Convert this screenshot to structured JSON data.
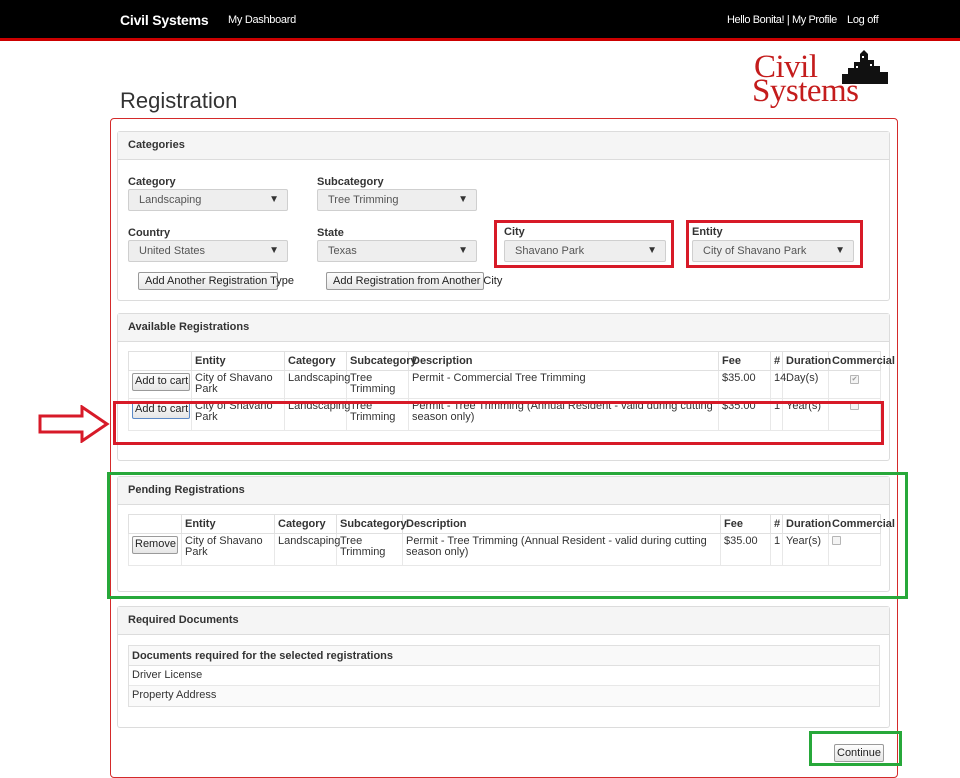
{
  "nav": {
    "brand": "Civil Systems",
    "dashboard": "My Dashboard",
    "greeting": "Hello Bonita! | My Profile",
    "logoff": "Log off"
  },
  "logo": {
    "line1": "Civil",
    "line2": "Systems"
  },
  "page_title": "Registration",
  "categories": {
    "heading": "Categories",
    "category_label": "Category",
    "category_value": "Landscaping",
    "subcategory_label": "Subcategory",
    "subcategory_value": "Tree Trimming",
    "country_label": "Country",
    "country_value": "United States",
    "state_label": "State",
    "state_value": "Texas",
    "city_label": "City",
    "city_value": "Shavano Park",
    "entity_label": "Entity",
    "entity_value": "City of Shavano Park",
    "add_type_button": "Add Another Registration Type",
    "add_city_button": "Add Registration from Another City"
  },
  "available": {
    "heading": "Available Registrations",
    "columns": [
      "Entity",
      "Category",
      "Subcategory",
      "Description",
      "Fee",
      "#",
      "Duration",
      "Commercial"
    ],
    "button_label": "Add to cart",
    "rows": [
      {
        "entity": "City of Shavano Park",
        "category": "Landscaping",
        "subcategory": "Tree Trimming",
        "description": "Permit - Commercial Tree Trimming",
        "fee": "$35.00",
        "count": "14",
        "duration": "Day(s)",
        "commercial": true
      },
      {
        "entity": "City of Shavano Park",
        "category": "Landscaping",
        "subcategory": "Tree Trimming",
        "description": "Permit - Tree Trimming (Annual Resident - valid during cutting season only)",
        "fee": "$35.00",
        "count": "1",
        "duration": "Year(s)",
        "commercial": false
      }
    ]
  },
  "pending": {
    "heading": "Pending Registrations",
    "columns": [
      "Entity",
      "Category",
      "Subcategory",
      "Description",
      "Fee",
      "#",
      "Duration",
      "Commercial"
    ],
    "button_label": "Remove",
    "rows": [
      {
        "entity": "City of Shavano Park",
        "category": "Landscaping",
        "subcategory": "Tree Trimming",
        "description": "Permit - Tree Trimming (Annual Resident - valid during cutting season only)",
        "fee": "$35.00",
        "count": "1",
        "duration": "Year(s)",
        "commercial": false
      }
    ]
  },
  "documents": {
    "heading": "Required Documents",
    "table_header": "Documents required for the selected registrations",
    "items": [
      "Driver License",
      "Property Address"
    ]
  },
  "continue_button": "Continue",
  "icons": {
    "select_arrow": "caret-down-icon",
    "annotation_arrow": "arrow-right-icon",
    "logo_skyline": "city-skyline-icon"
  },
  "colors": {
    "nav_bg": "#000000",
    "nav_accent": "#cc0000",
    "highlight_red": "#d71a28",
    "highlight_green": "#27a83a",
    "logo_red": "#c41c1c"
  }
}
